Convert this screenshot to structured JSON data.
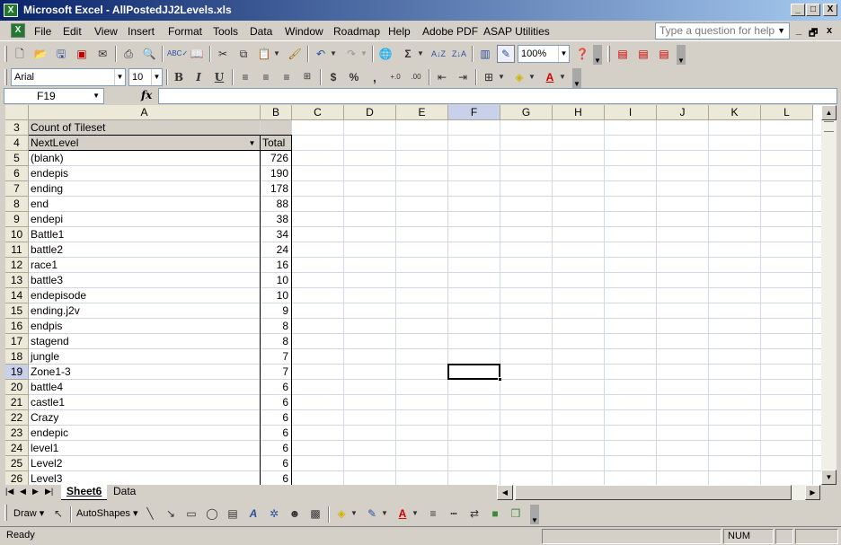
{
  "window": {
    "app_icon": "excel-icon",
    "title": "Microsoft Excel - AllPostedJJ2Levels.xls",
    "minimize": "_",
    "maximize": "□",
    "close": "X"
  },
  "menubar": {
    "items": [
      "File",
      "Edit",
      "View",
      "Insert",
      "Format",
      "Tools",
      "Data",
      "Window",
      "Roadmap",
      "Help",
      "Adobe PDF",
      "ASAP Utilities"
    ],
    "help_placeholder": "Type a question for help",
    "doc_min": "_",
    "doc_restore": "🗗",
    "doc_close": "x"
  },
  "standard_toolbar": {
    "zoom": "100%"
  },
  "formatting_toolbar": {
    "font": "Arial",
    "size": "10",
    "bold": "B",
    "italic": "I",
    "underline": "U",
    "currency": "$",
    "percent": "%",
    "comma": ","
  },
  "formula_bar": {
    "name_box": "F19",
    "fx": "fx",
    "formula": ""
  },
  "sheet": {
    "columns": [
      "A",
      "B",
      "C",
      "D",
      "E",
      "F",
      "G",
      "H",
      "I",
      "J",
      "K",
      "L"
    ],
    "selected_column": "F",
    "selected_row": "19",
    "rows": [
      {
        "n": "3",
        "a": "Count of Tileset",
        "b": ""
      },
      {
        "n": "4",
        "a": "NextLevel",
        "b": "Total"
      },
      {
        "n": "5",
        "a": "(blank)",
        "b": "726"
      },
      {
        "n": "6",
        "a": "endepis",
        "b": "190"
      },
      {
        "n": "7",
        "a": "ending",
        "b": "178"
      },
      {
        "n": "8",
        "a": "end",
        "b": "88"
      },
      {
        "n": "9",
        "a": "endepi",
        "b": "38"
      },
      {
        "n": "10",
        "a": "Battle1",
        "b": "34"
      },
      {
        "n": "11",
        "a": "battle2",
        "b": "24"
      },
      {
        "n": "12",
        "a": "race1",
        "b": "16"
      },
      {
        "n": "13",
        "a": "battle3",
        "b": "10"
      },
      {
        "n": "14",
        "a": "endepisode",
        "b": "10"
      },
      {
        "n": "15",
        "a": "ending.j2v",
        "b": "9"
      },
      {
        "n": "16",
        "a": "endpis",
        "b": "8"
      },
      {
        "n": "17",
        "a": "stagend",
        "b": "8"
      },
      {
        "n": "18",
        "a": "jungle",
        "b": "7"
      },
      {
        "n": "19",
        "a": "Zone1-3",
        "b": "7"
      },
      {
        "n": "20",
        "a": "battle4",
        "b": "6"
      },
      {
        "n": "21",
        "a": "castle1",
        "b": "6"
      },
      {
        "n": "22",
        "a": "Crazy",
        "b": "6"
      },
      {
        "n": "23",
        "a": "endepic",
        "b": "6"
      },
      {
        "n": "24",
        "a": "level1",
        "b": "6"
      },
      {
        "n": "25",
        "a": "Level2",
        "b": "6"
      },
      {
        "n": "26",
        "a": "Level3",
        "b": "6"
      }
    ]
  },
  "tabs": [
    "Sheet6",
    "Data"
  ],
  "active_tab": "Sheet6",
  "drawing_toolbar": {
    "draw": "Draw",
    "autoshapes": "AutoShapes"
  },
  "status": {
    "left": "Ready",
    "num": "NUM"
  },
  "colors": {
    "titlebar_start": "#0a246a",
    "selection_header": "#c9d1ea",
    "gridline": "#d0d7e5"
  }
}
